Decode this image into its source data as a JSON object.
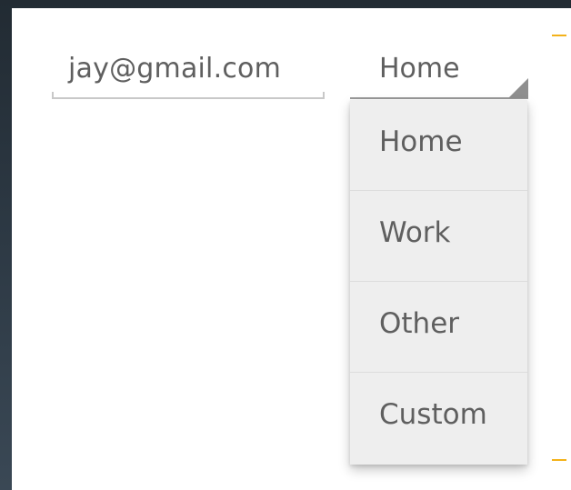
{
  "email_field": {
    "value": "jay@gmail.com"
  },
  "type_spinner": {
    "selected": "Home",
    "options": [
      "Home",
      "Work",
      "Other",
      "Custom"
    ]
  },
  "colors": {
    "background_top": "#222b33",
    "background_bottom": "#3a4855",
    "panel": "#ffffff",
    "text": "#5f5f5f",
    "dropdown": "#eeeeee",
    "accent": "#f3b21a"
  },
  "icons": {
    "spinner_indicator": "dropdown-triangle-icon"
  }
}
